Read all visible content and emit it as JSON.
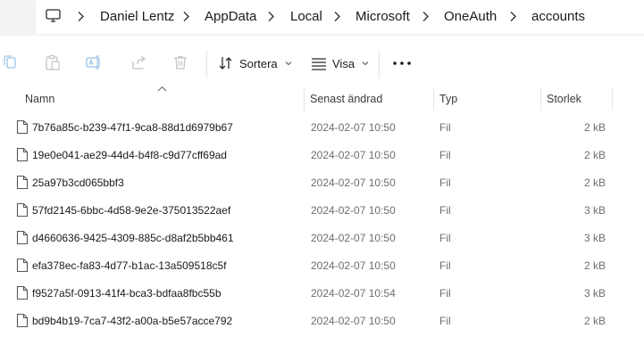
{
  "breadcrumb": {
    "root_icon": "this-pc-icon",
    "items": [
      "Daniel Lentz",
      "AppData",
      "Local",
      "Microsoft",
      "OneAuth",
      "accounts"
    ]
  },
  "toolbar": {
    "icons": [
      "copy-icon",
      "paste-icon",
      "rename-icon",
      "share-icon",
      "delete-icon"
    ],
    "sort_label": "Sortera",
    "view_label": "Visa",
    "more_label": "more-options-icon"
  },
  "columns": {
    "name": "Namn",
    "date": "Senast ändrad",
    "type": "Typ",
    "size": "Storlek"
  },
  "files": [
    {
      "name": "7b76a85c-b239-47f1-9ca8-88d1d6979b67",
      "date": "2024-02-07 10:50",
      "type": "Fil",
      "size": "2 kB"
    },
    {
      "name": "19e0e041-ae29-44d4-b4f8-c9d77cff69ad",
      "date": "2024-02-07 10:50",
      "type": "Fil",
      "size": "2 kB"
    },
    {
      "name": "25a97b3cd065bbf3",
      "date": "2024-02-07 10:50",
      "type": "Fil",
      "size": "2 kB"
    },
    {
      "name": "57fd2145-6bbc-4d58-9e2e-375013522aef",
      "date": "2024-02-07 10:50",
      "type": "Fil",
      "size": "3 kB"
    },
    {
      "name": "d4660636-9425-4309-885c-d8af2b5bb461",
      "date": "2024-02-07 10:50",
      "type": "Fil",
      "size": "3 kB"
    },
    {
      "name": "efa378ec-fa83-4d77-b1ac-13a509518c5f",
      "date": "2024-02-07 10:50",
      "type": "Fil",
      "size": "2 kB"
    },
    {
      "name": "f9527a5f-0913-41f4-bca3-bdfaa8fbc55b",
      "date": "2024-02-07 10:54",
      "type": "Fil",
      "size": "3 kB"
    },
    {
      "name": "bd9b4b19-7ca7-43f2-a00a-b5e57acce792",
      "date": "2024-02-07 10:50",
      "type": "Fil",
      "size": "2 kB"
    }
  ],
  "colors": {
    "accent": "#0067c0",
    "disabled_icon": "#c4c4c4",
    "header_bg": "#f3f3f3"
  }
}
